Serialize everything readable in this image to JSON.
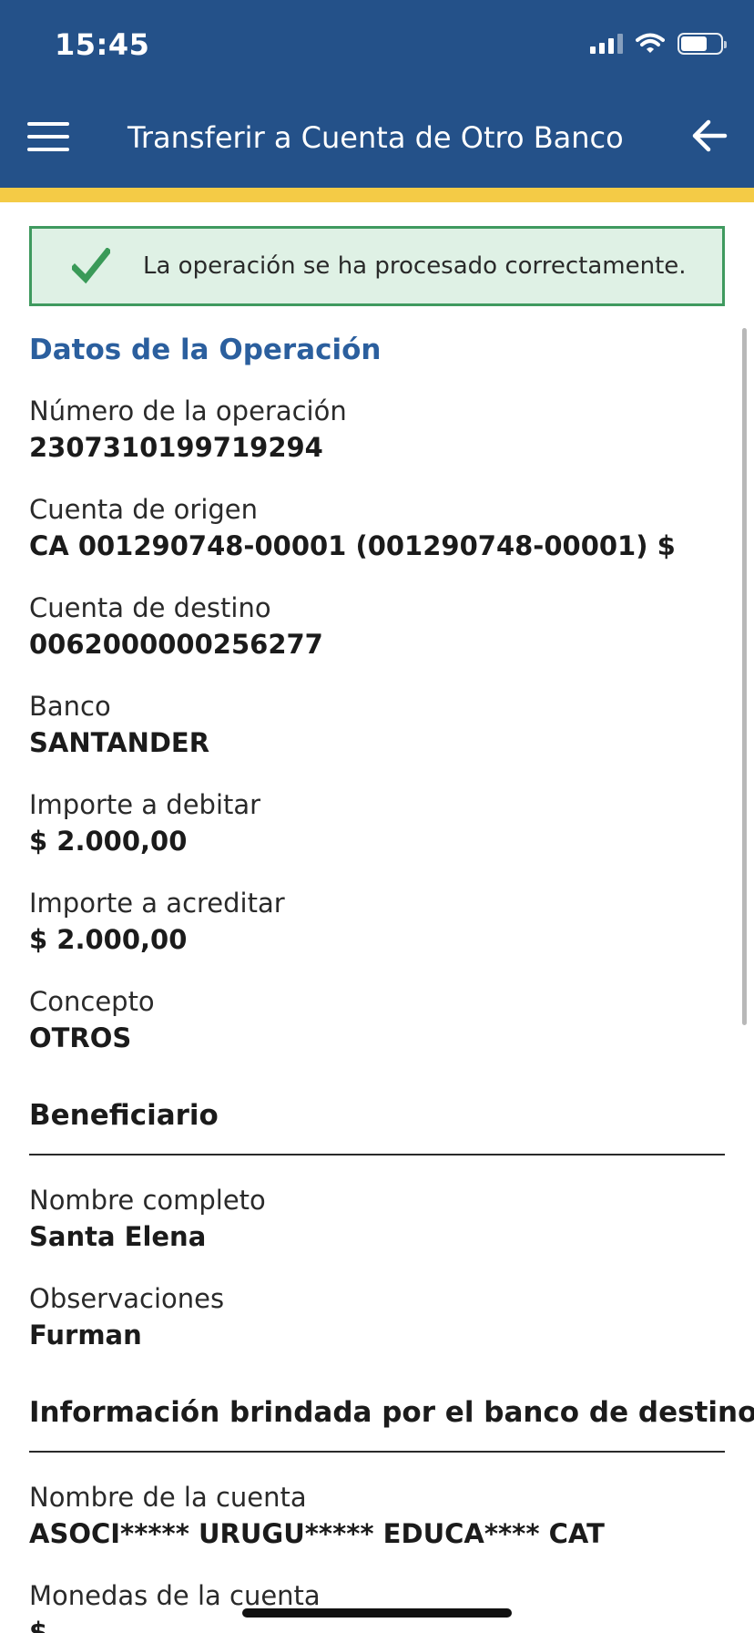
{
  "status_bar": {
    "time": "15:45"
  },
  "header": {
    "title": "Transferir a Cuenta de Otro Banco"
  },
  "alert": {
    "message": "La operación se ha procesado correctamente."
  },
  "operation": {
    "section_title": "Datos de la Operación",
    "fields": [
      {
        "label": "Número de la operación",
        "value": "2307310199719294"
      },
      {
        "label": "Cuenta de origen",
        "value": "CA 001290748-00001 (001290748-00001) $"
      },
      {
        "label": "Cuenta de destino",
        "value": "0062000000256277"
      },
      {
        "label": "Banco",
        "value": "SANTANDER"
      },
      {
        "label": "Importe a debitar",
        "value": "$ 2.000,00"
      },
      {
        "label": "Importe a acreditar",
        "value": "$ 2.000,00"
      },
      {
        "label": "Concepto",
        "value": "OTROS"
      }
    ]
  },
  "beneficiary": {
    "section_title": "Beneficiario",
    "fields": [
      {
        "label": "Nombre completo",
        "value": "Santa Elena"
      },
      {
        "label": "Observaciones",
        "value": "Furman"
      }
    ]
  },
  "destination_bank_info": {
    "section_title": "Información brindada por el banco de destino",
    "fields": [
      {
        "label": "Nombre de la cuenta",
        "value": "ASOCI***** URUGU***** EDUCA**** CAT"
      },
      {
        "label": "Monedas de la cuenta",
        "value": "$"
      }
    ]
  },
  "colors": {
    "header_bg": "#245189",
    "accent_stripe": "#f4cb46",
    "success_border": "#3f9a5f",
    "success_bg": "#dff1e5",
    "section_title": "#2b5f9e"
  },
  "icons": {
    "menu": "hamburger-menu-icon",
    "back": "arrow-left-icon",
    "success": "checkmark-icon",
    "signal": "cellular-signal-icon",
    "wifi": "wifi-icon",
    "battery": "battery-icon"
  }
}
